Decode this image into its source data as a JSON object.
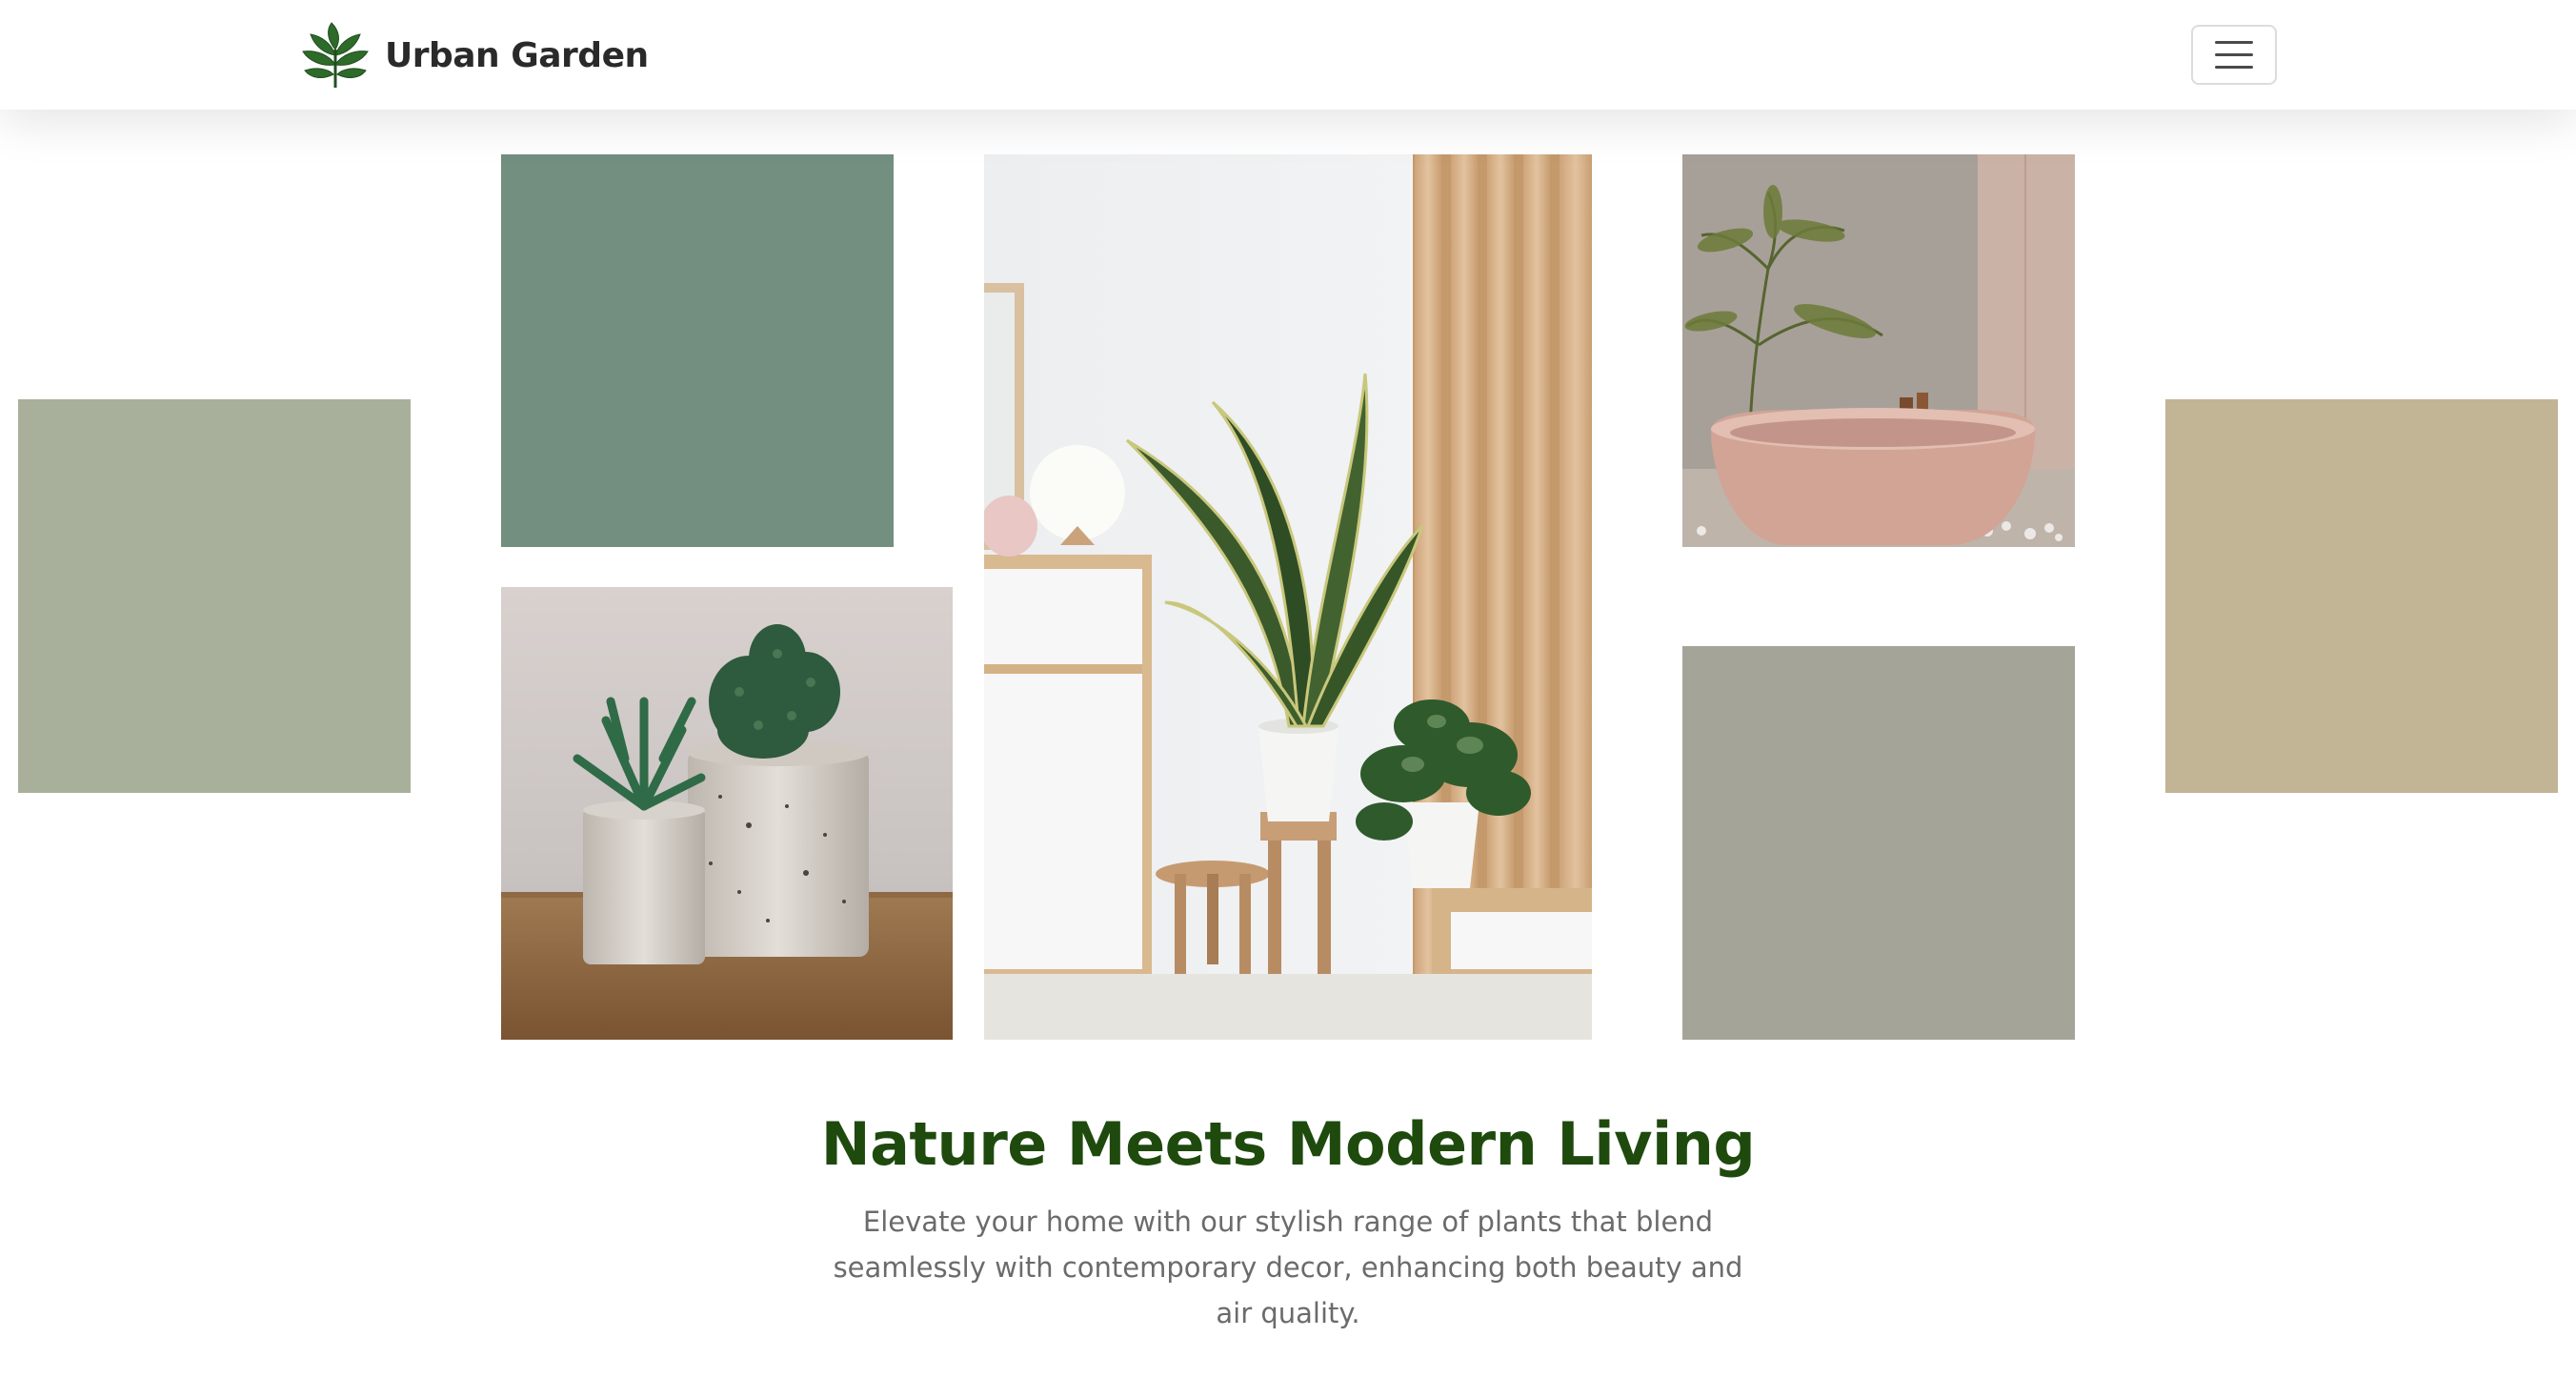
{
  "header": {
    "brand_name": "Urban Garden",
    "logo_icon": "leaf-icon",
    "menu_icon": "hamburger-menu-icon"
  },
  "gallery": {
    "tiles": [
      {
        "kind": "color-swatch",
        "color": "#a8b09b"
      },
      {
        "kind": "color-swatch",
        "color": "#728f80"
      },
      {
        "kind": "photo",
        "subject": "potted cacti on wooden table"
      },
      {
        "kind": "photo",
        "subject": "snake plant and pothos beside white cabinet and wood slat wall"
      },
      {
        "kind": "photo",
        "subject": "pink bathtub with palm plant"
      },
      {
        "kind": "color-swatch",
        "color": "#a4a498"
      },
      {
        "kind": "color-swatch",
        "color": "#c2b595"
      }
    ]
  },
  "hero": {
    "title": "Nature Meets Modern Living",
    "subtitle": "Elevate your home with our stylish range of plants that blend seamlessly with contemporary decor, enhancing both beauty and air quality."
  },
  "colors": {
    "brand_green": "#1f4a0e",
    "text_dark": "#2a2a2a",
    "text_muted": "#6b6b6b"
  }
}
